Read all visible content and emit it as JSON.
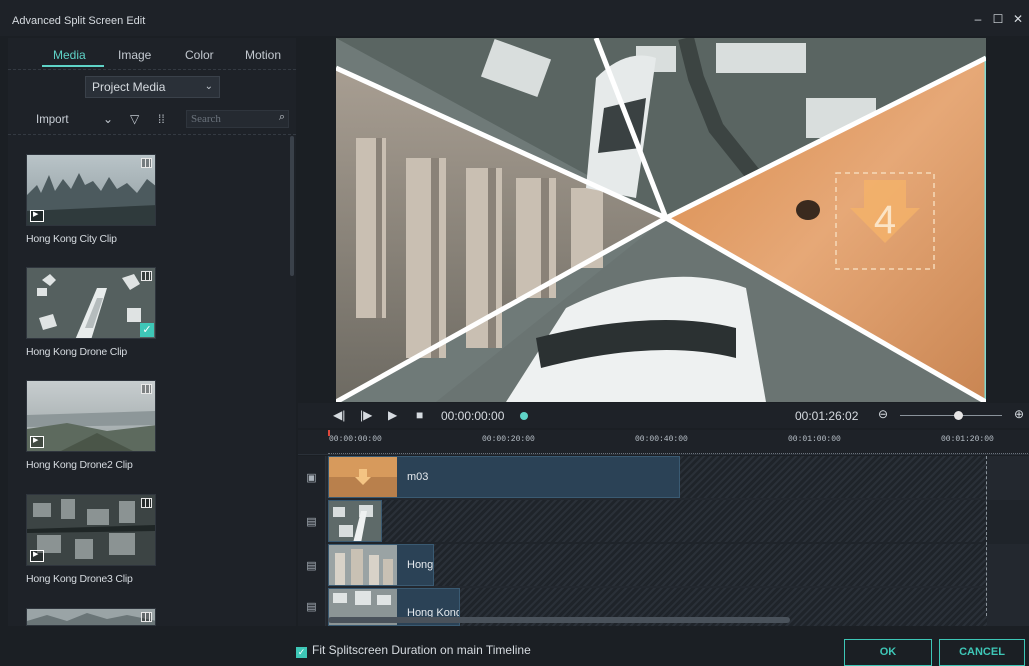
{
  "window": {
    "title": "Advanced Split Screen Edit",
    "minimize": "–",
    "maximize": "☐",
    "close": "✕"
  },
  "left_panel": {
    "tabs": [
      "Media",
      "Image",
      "Color",
      "Motion"
    ],
    "active_tab": "Media",
    "source_select": "Project Media",
    "import_label": "Import",
    "search_placeholder": "Search",
    "clips": [
      {
        "label": "Hong Kong City Clip",
        "selected": false
      },
      {
        "label": "Hong Kong Drone Clip",
        "selected": true
      },
      {
        "label": "Hong Kong Drone2 Clip",
        "selected": false
      },
      {
        "label": "Hong Kong Drone3 Clip",
        "selected": false
      }
    ]
  },
  "preview": {
    "overlay_number": "4"
  },
  "transport": {
    "current_time": "00:00:00:00",
    "duration": "00:01:26:02",
    "zoom_level": 0.55
  },
  "timeline": {
    "ruler_ticks": [
      "00:00:00:00",
      "00:00:20:00",
      "00:00:40:00",
      "00:01:00:00",
      "00:01:20:00"
    ],
    "tracks": [
      {
        "type": "image",
        "clip_name": "m03"
      },
      {
        "type": "video",
        "clip_name": ""
      },
      {
        "type": "video",
        "clip_name": "Hong"
      },
      {
        "type": "video",
        "clip_name": "Hong Kong"
      }
    ]
  },
  "footer": {
    "fit_label": "Fit Splitscreen Duration on main Timeline",
    "fit_checked": true,
    "ok_label": "OK",
    "cancel_label": "CANCEL"
  },
  "colors": {
    "accent": "#3ec7b7",
    "background": "#1b1f24",
    "clip": "#2b4256"
  }
}
